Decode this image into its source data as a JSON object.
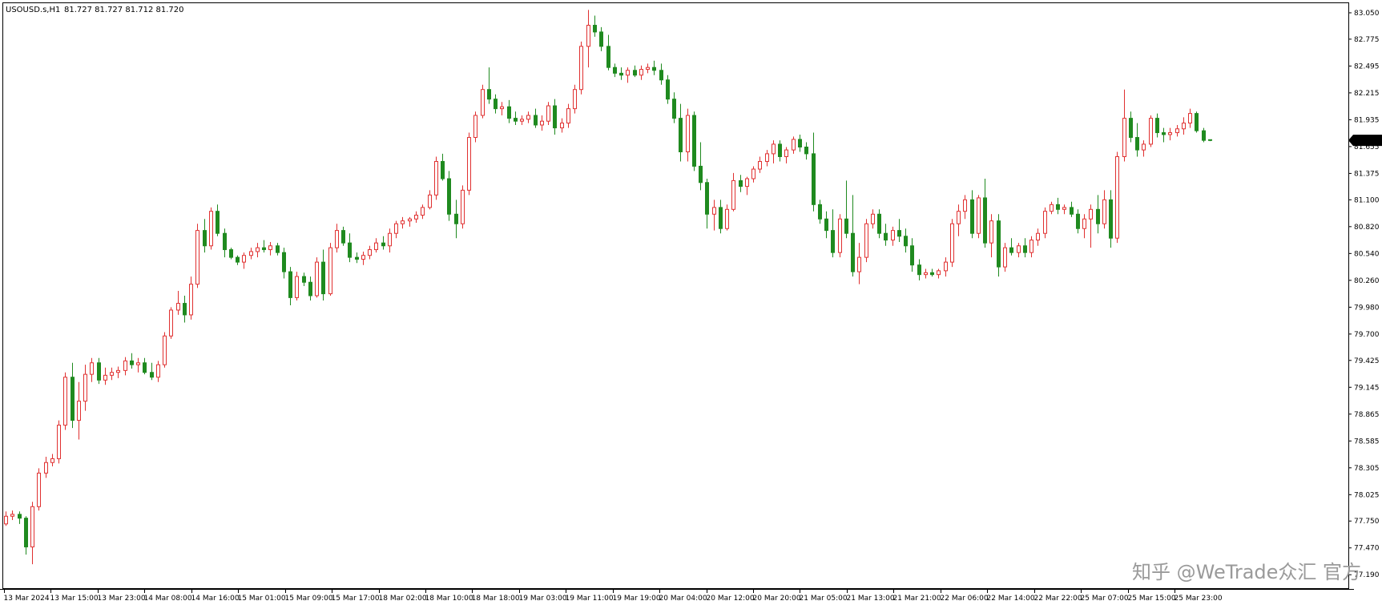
{
  "header": {
    "symbol": "USOUSD.s,H1",
    "ohlc": "81.727 81.727 81.712 81.720"
  },
  "watermark": "知乎 @WeTrade众汇 官方",
  "colors": {
    "bull": "#e03030",
    "bear": "#1f8a1f",
    "frame": "#000000",
    "background": "#ffffff",
    "price_tag_bg": "#000000",
    "price_tag_text": "#ffffff"
  },
  "chart_data": {
    "type": "candlestick",
    "symbol": "USOUSD.s",
    "timeframe": "H1",
    "current_price": "81.720",
    "ylim": [
      77.05,
      83.15
    ],
    "y_ticks": [
      "83.050",
      "82.775",
      "82.495",
      "82.215",
      "81.935",
      "81.655",
      "81.375",
      "81.100",
      "80.820",
      "80.540",
      "80.260",
      "79.980",
      "79.700",
      "79.425",
      "79.145",
      "78.865",
      "78.585",
      "78.305",
      "78.025",
      "77.750",
      "77.470",
      "77.190"
    ],
    "x_ticks": [
      "13 Mar 2024",
      "13 Mar 15:00",
      "13 Mar 23:00",
      "14 Mar 08:00",
      "14 Mar 16:00",
      "15 Mar 01:00",
      "15 Mar 09:00",
      "15 Mar 17:00",
      "18 Mar 02:00",
      "18 Mar 10:00",
      "18 Mar 18:00",
      "19 Mar 03:00",
      "19 Mar 11:00",
      "19 Mar 19:00",
      "20 Mar 04:00",
      "20 Mar 12:00",
      "20 Mar 20:00",
      "21 Mar 05:00",
      "21 Mar 13:00",
      "21 Mar 21:00",
      "22 Mar 06:00",
      "22 Mar 14:00",
      "22 Mar 22:00",
      "25 Mar 07:00",
      "25 Mar 15:00",
      "25 Mar 23:00"
    ],
    "candles": [
      [
        77.72,
        77.85,
        77.7,
        77.8
      ],
      [
        77.8,
        77.86,
        77.76,
        77.82
      ],
      [
        77.82,
        77.85,
        77.72,
        77.78
      ],
      [
        77.78,
        77.8,
        77.4,
        77.48
      ],
      [
        77.48,
        77.95,
        77.3,
        77.9
      ],
      [
        77.9,
        78.3,
        77.86,
        78.25
      ],
      [
        78.25,
        78.42,
        78.2,
        78.36
      ],
      [
        78.36,
        78.45,
        78.32,
        78.4
      ],
      [
        78.4,
        78.8,
        78.35,
        78.75
      ],
      [
        78.75,
        79.3,
        78.7,
        79.25
      ],
      [
        79.25,
        79.4,
        78.72,
        78.8
      ],
      [
        78.8,
        79.2,
        78.6,
        79.0
      ],
      [
        79.0,
        79.38,
        78.9,
        79.28
      ],
      [
        79.28,
        79.45,
        79.2,
        79.4
      ],
      [
        79.4,
        79.45,
        79.18,
        79.22
      ],
      [
        79.22,
        79.35,
        79.17,
        79.27
      ],
      [
        79.27,
        79.35,
        79.22,
        79.3
      ],
      [
        79.3,
        79.36,
        79.24,
        79.32
      ],
      [
        79.32,
        79.46,
        79.27,
        79.42
      ],
      [
        79.42,
        79.5,
        79.34,
        79.38
      ],
      [
        79.38,
        79.45,
        79.3,
        79.4
      ],
      [
        79.4,
        79.45,
        79.28,
        79.3
      ],
      [
        79.3,
        79.4,
        79.22,
        79.25
      ],
      [
        79.25,
        79.42,
        79.2,
        79.38
      ],
      [
        79.38,
        79.72,
        79.35,
        79.68
      ],
      [
        79.68,
        79.98,
        79.65,
        79.95
      ],
      [
        79.95,
        80.15,
        79.9,
        80.02
      ],
      [
        80.02,
        80.1,
        79.82,
        79.9
      ],
      [
        79.9,
        80.3,
        79.85,
        80.22
      ],
      [
        80.22,
        80.85,
        80.18,
        80.78
      ],
      [
        80.78,
        80.9,
        80.55,
        80.62
      ],
      [
        80.62,
        81.02,
        80.58,
        80.98
      ],
      [
        80.98,
        81.05,
        80.72,
        80.75
      ],
      [
        80.75,
        80.8,
        80.5,
        80.58
      ],
      [
        80.58,
        80.6,
        80.48,
        80.5
      ],
      [
        80.5,
        80.52,
        80.42,
        80.45
      ],
      [
        80.45,
        80.55,
        80.38,
        80.52
      ],
      [
        80.52,
        80.6,
        80.48,
        80.56
      ],
      [
        80.56,
        80.65,
        80.5,
        80.6
      ],
      [
        80.6,
        80.68,
        80.55,
        80.58
      ],
      [
        80.58,
        80.66,
        80.52,
        80.62
      ],
      [
        80.62,
        80.65,
        80.52,
        80.55
      ],
      [
        80.55,
        80.6,
        80.28,
        80.35
      ],
      [
        80.35,
        80.4,
        80.0,
        80.08
      ],
      [
        80.08,
        80.35,
        80.05,
        80.3
      ],
      [
        80.3,
        80.34,
        80.2,
        80.24
      ],
      [
        80.24,
        80.3,
        80.05,
        80.1
      ],
      [
        80.1,
        80.5,
        80.08,
        80.45
      ],
      [
        80.45,
        80.58,
        80.05,
        80.12
      ],
      [
        80.12,
        80.65,
        80.1,
        80.6
      ],
      [
        80.6,
        80.85,
        80.55,
        80.78
      ],
      [
        80.78,
        80.82,
        80.62,
        80.65
      ],
      [
        80.65,
        80.75,
        80.45,
        80.5
      ],
      [
        80.5,
        80.55,
        80.44,
        80.48
      ],
      [
        80.48,
        80.56,
        80.42,
        80.52
      ],
      [
        80.52,
        80.62,
        80.48,
        80.58
      ],
      [
        80.58,
        80.7,
        80.55,
        80.65
      ],
      [
        80.65,
        80.72,
        80.58,
        80.62
      ],
      [
        80.62,
        80.8,
        80.55,
        80.75
      ],
      [
        80.75,
        80.88,
        80.7,
        80.85
      ],
      [
        80.85,
        80.92,
        80.8,
        80.88
      ],
      [
        80.88,
        80.92,
        80.82,
        80.9
      ],
      [
        80.9,
        80.98,
        80.86,
        80.94
      ],
      [
        80.94,
        81.05,
        80.9,
        81.02
      ],
      [
        81.02,
        81.2,
        81.0,
        81.15
      ],
      [
        81.15,
        81.55,
        81.1,
        81.5
      ],
      [
        81.5,
        81.58,
        81.3,
        81.32
      ],
      [
        81.32,
        81.4,
        80.88,
        80.95
      ],
      [
        80.95,
        81.1,
        80.7,
        80.85
      ],
      [
        80.85,
        81.25,
        80.8,
        81.2
      ],
      [
        81.2,
        81.8,
        81.15,
        81.75
      ],
      [
        81.75,
        82.02,
        81.7,
        81.98
      ],
      [
        81.98,
        82.3,
        81.95,
        82.25
      ],
      [
        82.25,
        82.48,
        82.1,
        82.15
      ],
      [
        82.15,
        82.2,
        82.0,
        82.05
      ],
      [
        82.05,
        82.12,
        81.98,
        82.07
      ],
      [
        82.07,
        82.14,
        81.9,
        81.95
      ],
      [
        81.95,
        82.02,
        81.88,
        81.92
      ],
      [
        81.92,
        81.98,
        81.88,
        81.94
      ],
      [
        81.94,
        82.02,
        81.9,
        81.98
      ],
      [
        81.98,
        82.05,
        81.85,
        81.88
      ],
      [
        81.88,
        81.98,
        81.82,
        81.92
      ],
      [
        81.92,
        82.12,
        81.88,
        82.08
      ],
      [
        82.08,
        82.15,
        81.78,
        81.85
      ],
      [
        81.85,
        81.95,
        81.8,
        81.9
      ],
      [
        81.9,
        82.1,
        81.85,
        82.05
      ],
      [
        82.05,
        82.3,
        82.0,
        82.25
      ],
      [
        82.25,
        82.75,
        82.2,
        82.7
      ],
      [
        82.7,
        83.08,
        82.48,
        82.92
      ],
      [
        82.92,
        83.02,
        82.8,
        82.85
      ],
      [
        82.85,
        82.9,
        82.65,
        82.7
      ],
      [
        82.7,
        82.82,
        82.45,
        82.48
      ],
      [
        82.48,
        82.52,
        82.38,
        82.42
      ],
      [
        82.42,
        82.48,
        82.35,
        82.4
      ],
      [
        82.4,
        82.48,
        82.32,
        82.45
      ],
      [
        82.45,
        82.5,
        82.38,
        82.4
      ],
      [
        82.4,
        82.5,
        82.35,
        82.46
      ],
      [
        82.46,
        82.52,
        82.42,
        82.48
      ],
      [
        82.48,
        82.55,
        82.4,
        82.45
      ],
      [
        82.45,
        82.52,
        82.3,
        82.35
      ],
      [
        82.35,
        82.4,
        82.1,
        82.15
      ],
      [
        82.15,
        82.22,
        81.9,
        81.95
      ],
      [
        81.95,
        82.1,
        81.5,
        81.6
      ],
      [
        81.6,
        82.05,
        81.5,
        81.98
      ],
      [
        81.98,
        82.02,
        81.4,
        81.45
      ],
      [
        81.45,
        81.7,
        81.2,
        81.28
      ],
      [
        81.28,
        81.32,
        80.8,
        80.95
      ],
      [
        80.95,
        81.1,
        80.78,
        81.02
      ],
      [
        81.02,
        81.1,
        80.75,
        80.8
      ],
      [
        80.8,
        81.05,
        80.78,
        81.0
      ],
      [
        81.0,
        81.38,
        80.98,
        81.3
      ],
      [
        81.3,
        81.36,
        81.18,
        81.24
      ],
      [
        81.24,
        81.34,
        81.15,
        81.32
      ],
      [
        81.32,
        81.45,
        81.28,
        81.42
      ],
      [
        81.42,
        81.55,
        81.38,
        81.5
      ],
      [
        81.5,
        81.62,
        81.45,
        81.58
      ],
      [
        81.58,
        81.72,
        81.48,
        81.68
      ],
      [
        81.68,
        81.72,
        81.5,
        81.55
      ],
      [
        81.55,
        81.65,
        81.48,
        81.62
      ],
      [
        81.62,
        81.76,
        81.58,
        81.73
      ],
      [
        81.73,
        81.78,
        81.6,
        81.65
      ],
      [
        81.65,
        81.7,
        81.52,
        81.58
      ],
      [
        81.58,
        81.8,
        80.98,
        81.05
      ],
      [
        81.05,
        81.1,
        80.85,
        80.9
      ],
      [
        80.9,
        80.98,
        80.7,
        80.78
      ],
      [
        80.78,
        81.0,
        80.5,
        80.55
      ],
      [
        80.55,
        80.95,
        80.5,
        80.9
      ],
      [
        80.9,
        81.3,
        80.7,
        80.75
      ],
      [
        80.75,
        81.15,
        80.3,
        80.35
      ],
      [
        80.35,
        80.65,
        80.22,
        80.5
      ],
      [
        80.5,
        80.9,
        80.45,
        80.85
      ],
      [
        80.85,
        81.0,
        80.8,
        80.95
      ],
      [
        80.95,
        81.0,
        80.7,
        80.75
      ],
      [
        80.75,
        80.85,
        80.62,
        80.68
      ],
      [
        80.68,
        80.82,
        80.62,
        80.78
      ],
      [
        80.78,
        80.9,
        80.66,
        80.72
      ],
      [
        80.72,
        80.8,
        80.55,
        80.62
      ],
      [
        80.62,
        80.7,
        80.35,
        80.42
      ],
      [
        80.42,
        80.48,
        80.26,
        80.32
      ],
      [
        80.32,
        80.38,
        80.28,
        80.34
      ],
      [
        80.34,
        80.38,
        80.3,
        80.32
      ],
      [
        80.32,
        80.38,
        80.28,
        80.36
      ],
      [
        80.36,
        80.5,
        80.3,
        80.45
      ],
      [
        80.45,
        80.9,
        80.4,
        80.85
      ],
      [
        80.85,
        81.05,
        80.72,
        80.98
      ],
      [
        80.98,
        81.15,
        80.9,
        81.1
      ],
      [
        81.1,
        81.2,
        80.7,
        80.75
      ],
      [
        80.75,
        81.15,
        80.7,
        81.12
      ],
      [
        81.12,
        81.32,
        80.6,
        80.65
      ],
      [
        80.65,
        80.95,
        80.5,
        80.88
      ],
      [
        80.88,
        80.95,
        80.3,
        80.4
      ],
      [
        80.4,
        80.65,
        80.35,
        80.6
      ],
      [
        80.6,
        80.7,
        80.52,
        80.55
      ],
      [
        80.55,
        80.65,
        80.5,
        80.62
      ],
      [
        80.62,
        80.7,
        80.5,
        80.55
      ],
      [
        80.55,
        80.72,
        80.5,
        80.68
      ],
      [
        80.68,
        80.8,
        80.62,
        80.75
      ],
      [
        80.75,
        81.02,
        80.7,
        80.98
      ],
      [
        80.98,
        81.08,
        80.95,
        81.05
      ],
      [
        81.05,
        81.12,
        80.95,
        81.0
      ],
      [
        81.0,
        81.05,
        80.95,
        81.02
      ],
      [
        81.02,
        81.08,
        80.92,
        80.95
      ],
      [
        80.95,
        81.0,
        80.75,
        80.8
      ],
      [
        80.8,
        80.95,
        80.7,
        80.9
      ],
      [
        80.9,
        81.05,
        80.6,
        81.0
      ],
      [
        81.0,
        81.15,
        80.75,
        80.85
      ],
      [
        80.85,
        81.2,
        80.8,
        81.1
      ],
      [
        81.1,
        81.2,
        80.6,
        80.7
      ],
      [
        80.7,
        81.6,
        80.65,
        81.55
      ],
      [
        81.55,
        82.25,
        81.5,
        81.95
      ],
      [
        81.95,
        82.02,
        81.7,
        81.75
      ],
      [
        81.75,
        81.9,
        81.55,
        81.62
      ],
      [
        81.62,
        81.72,
        81.55,
        81.68
      ],
      [
        81.68,
        81.98,
        81.65,
        81.95
      ],
      [
        81.95,
        82.0,
        81.75,
        81.8
      ],
      [
        81.8,
        81.85,
        81.7,
        81.78
      ],
      [
        81.78,
        81.85,
        81.72,
        81.8
      ],
      [
        81.8,
        81.88,
        81.76,
        81.84
      ],
      [
        81.84,
        81.96,
        81.78,
        81.9
      ],
      [
        81.9,
        82.05,
        81.85,
        82.0
      ],
      [
        82.0,
        82.02,
        81.8,
        81.82
      ],
      [
        81.82,
        81.85,
        81.7,
        81.72
      ],
      [
        81.727,
        81.727,
        81.712,
        81.72
      ]
    ]
  }
}
